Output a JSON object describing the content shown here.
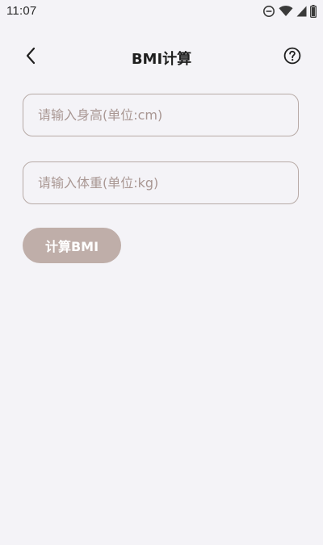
{
  "status_bar": {
    "time": "11:07",
    "icons": [
      "do-not-disturb-icon",
      "wifi-icon",
      "signal-icon",
      "battery-icon"
    ]
  },
  "header": {
    "title": "BMI计算",
    "back_icon": "chevron-left-icon",
    "help_icon": "help-circle-icon"
  },
  "form": {
    "height_input": {
      "placeholder": "请输入身高(单位:cm)",
      "value": ""
    },
    "weight_input": {
      "placeholder": "请输入体重(单位:kg)",
      "value": ""
    },
    "calculate_button": {
      "label": "计算BMI"
    }
  },
  "colors": {
    "background": "#f4f3f7",
    "input_border": "#b7aaa6",
    "placeholder": "#a99793",
    "button_bg": "#bfaea9",
    "button_text": "#ffffff",
    "title_text": "#1f1f1f"
  }
}
